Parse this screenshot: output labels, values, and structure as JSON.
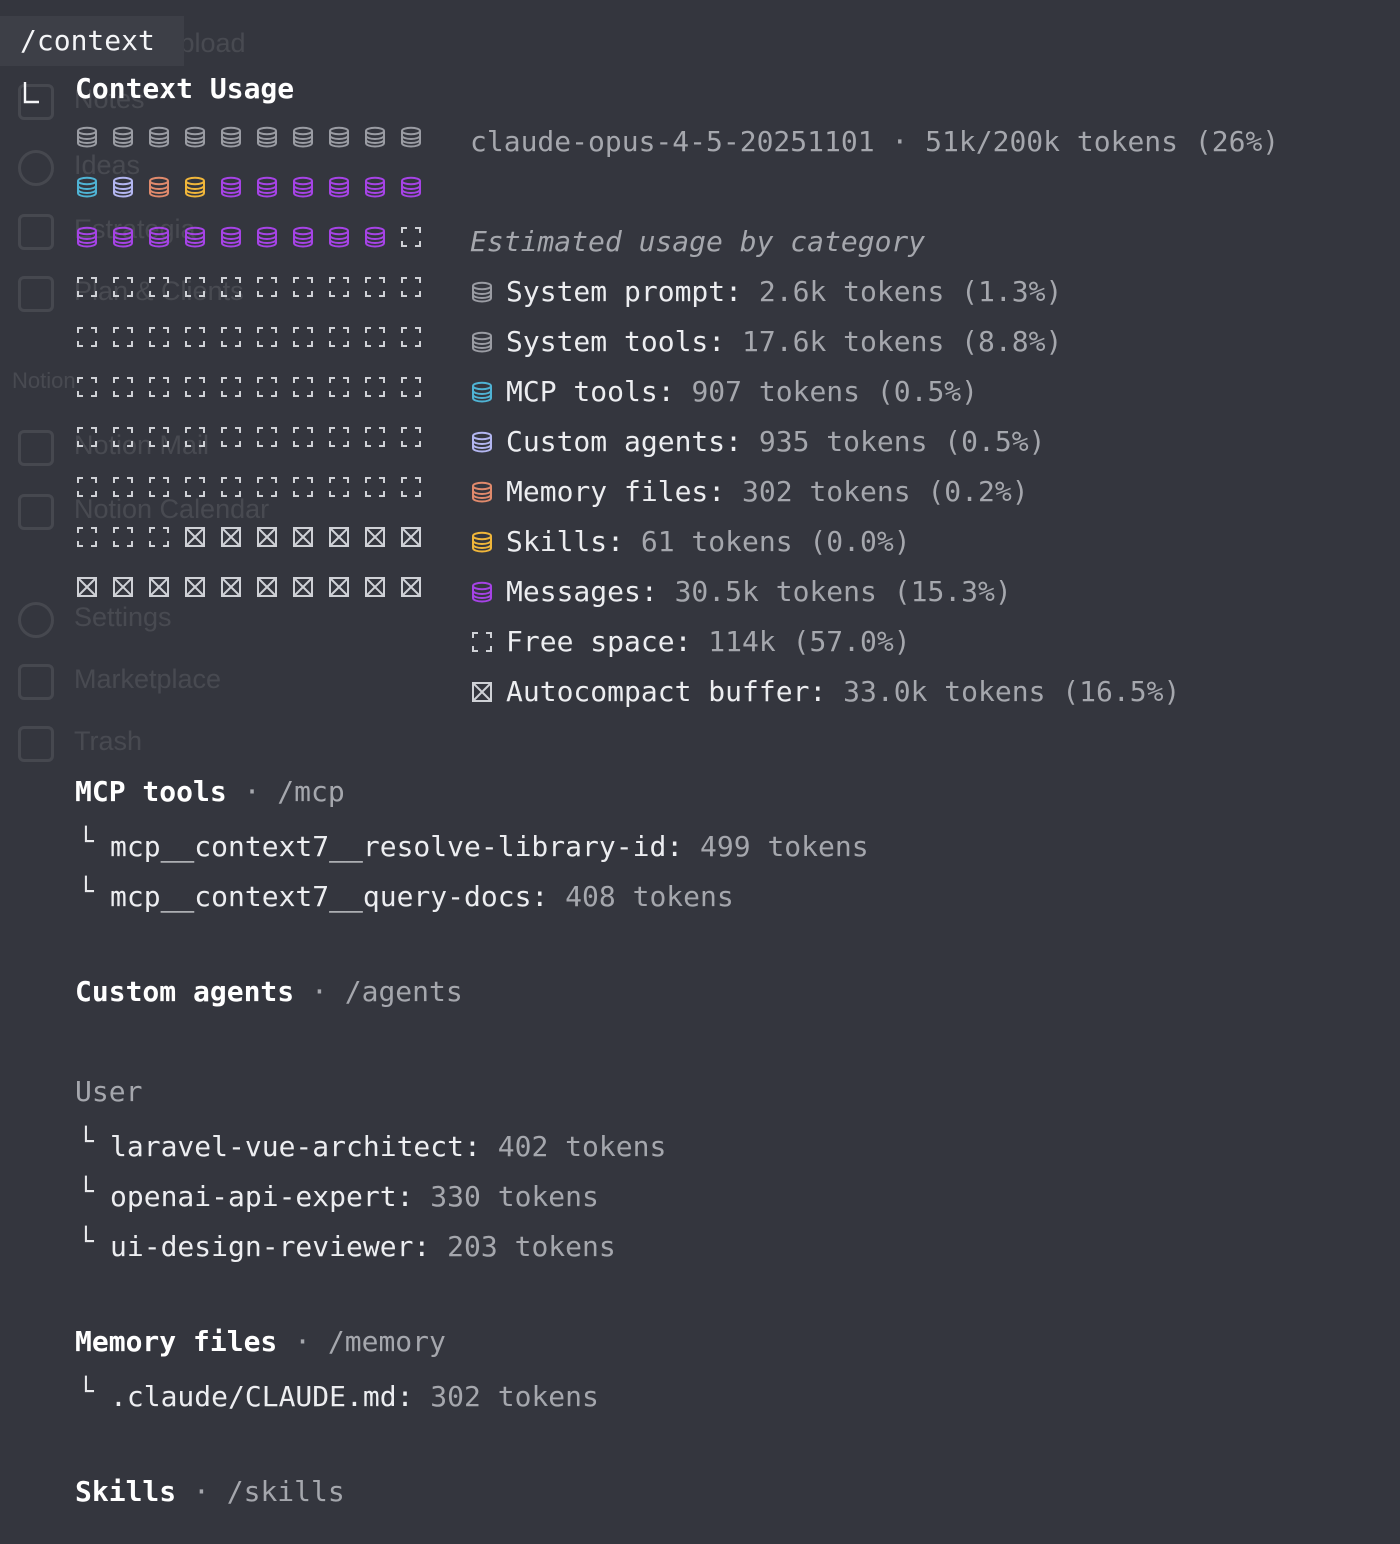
{
  "command": "/context",
  "title": "Context Usage",
  "model_line": "claude-opus-4-5-20251101 · 51k/200k tokens (26%)",
  "legend_heading": "Estimated usage by category",
  "categories": [
    {
      "key": "system_prompt",
      "label": "System prompt:",
      "value": "2.6k tokens (1.3%)",
      "color": "#9a9ca3",
      "glyph": "db",
      "cells": 3
    },
    {
      "key": "system_tools",
      "label": "System tools:",
      "value": "17.6k tokens (8.8%)",
      "color": "#9a9ca3",
      "glyph": "db",
      "cells": 7
    },
    {
      "key": "mcp_tools",
      "label": "MCP tools:",
      "value": "907 tokens (0.5%)",
      "color": "#4fb3d4",
      "glyph": "db",
      "cells": 1
    },
    {
      "key": "custom_agents",
      "label": "Custom agents:",
      "value": "935 tokens (0.5%)",
      "color": "#b3b6f0",
      "glyph": "db",
      "cells": 1
    },
    {
      "key": "memory_files",
      "label": "Memory files:",
      "value": "302 tokens (0.2%)",
      "color": "#e08a6c",
      "glyph": "db",
      "cells": 1
    },
    {
      "key": "skills",
      "label": "Skills:",
      "value": "61 tokens (0.0%)",
      "color": "#f0b63a",
      "glyph": "db",
      "cells": 1
    },
    {
      "key": "messages",
      "label": "Messages:",
      "value": "30.5k tokens (15.3%)",
      "color": "#a643e6",
      "glyph": "db",
      "cells": 15
    },
    {
      "key": "free_space",
      "label": "Free space:",
      "value": "114k (57.0%)",
      "color": "#cfd1d6",
      "glyph": "free",
      "cells": 54
    },
    {
      "key": "autocompact",
      "label": "Autocompact buffer:",
      "value": "33.0k tokens (16.5%)",
      "color": "#cfd1d6",
      "glyph": "buffer",
      "cells": 17
    }
  ],
  "sections": {
    "mcp": {
      "heading": "MCP tools",
      "sep": "·",
      "path": "/mcp",
      "items": [
        {
          "name": "mcp__context7__resolve-library-id:",
          "value": "499 tokens"
        },
        {
          "name": "mcp__context7__query-docs:",
          "value": "408 tokens"
        }
      ]
    },
    "agents": {
      "heading": "Custom agents",
      "sep": "·",
      "path": "/agents",
      "group": "User",
      "items": [
        {
          "name": "laravel-vue-architect:",
          "value": "402 tokens"
        },
        {
          "name": "openai-api-expert:",
          "value": "330 tokens"
        },
        {
          "name": "ui-design-reviewer:",
          "value": "203 tokens"
        }
      ]
    },
    "memory": {
      "heading": "Memory files",
      "sep": "·",
      "path": "/memory",
      "items": [
        {
          "name": ".claude/CLAUDE.md:",
          "value": "302 tokens"
        }
      ]
    },
    "skills": {
      "heading": "Skills",
      "sep": "·",
      "path": "/skills"
    }
  },
  "ghost_sidebar": [
    "Upload",
    "Notes",
    "Ideas",
    "Estrategia",
    "Plan & Clients",
    "Notion",
    "Notion Mail",
    "Notion Calendar",
    "Settings",
    "Marketplace",
    "Trash"
  ]
}
